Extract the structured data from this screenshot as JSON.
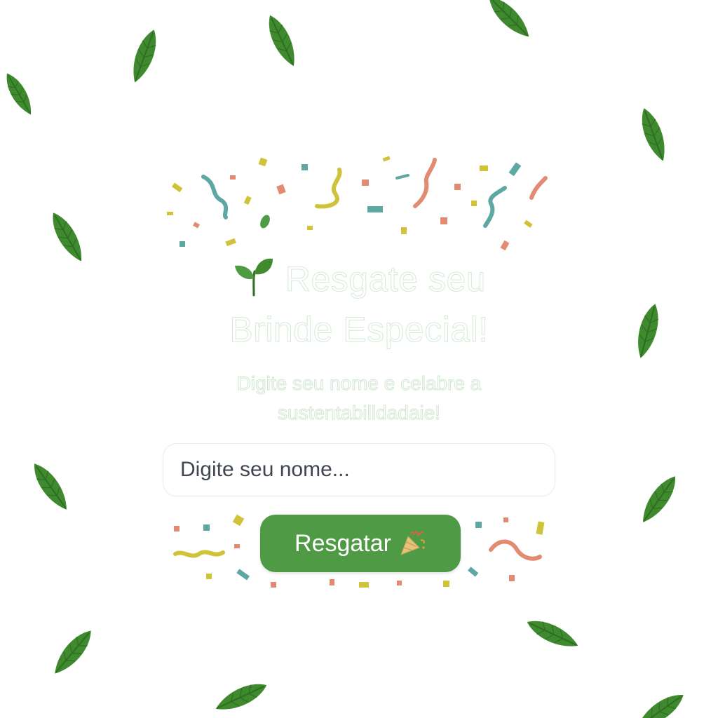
{
  "card": {
    "title_line1": "Resgate seu",
    "title_line2": "Brinde Especial!",
    "subtitle_line1": "Digite seu nome e celabre a",
    "subtitle_line2": "sustentabilldadaie!",
    "title_icon": "sprout-icon"
  },
  "form": {
    "name_placeholder": "Digite seu nome...",
    "name_value": "",
    "submit_label": "Resgatar",
    "submit_icon": "party-popper-icon"
  },
  "colors": {
    "button": "#4f9a45",
    "leaf": "#3f8a2e",
    "leaf_dark": "#2e6e22",
    "confetti_yellow": "#cfc33a",
    "confetti_teal": "#5ea8a4",
    "confetti_coral": "#e28a72",
    "confetti_green": "#4f9a45"
  }
}
